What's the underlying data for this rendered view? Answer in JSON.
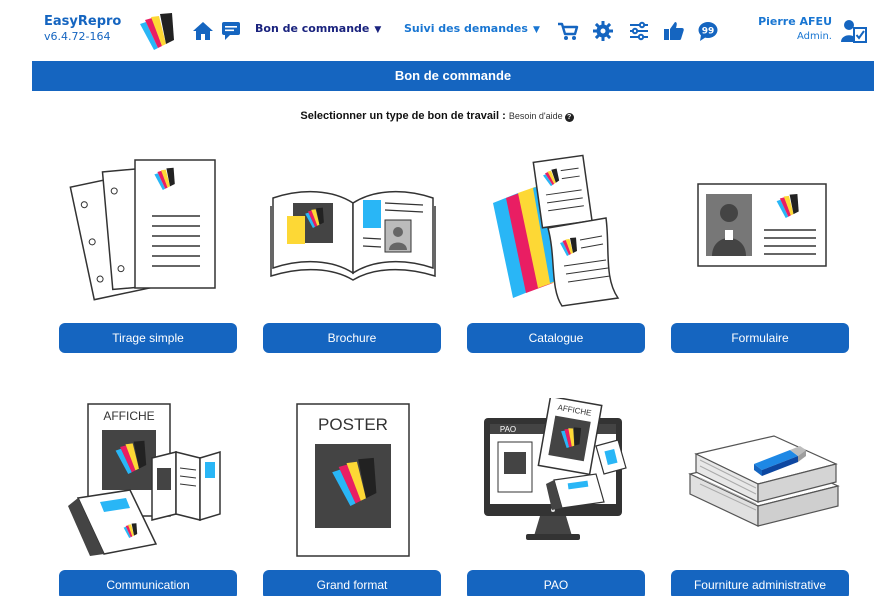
{
  "app": {
    "name": "EasyRepro",
    "version": "v6.4.72-164"
  },
  "nav": {
    "home_icon": "home-icon",
    "chat_icon": "chat-icon",
    "order_menu": "Bon de commande",
    "requests_menu": "Suivi des demandes",
    "cart_icon": "cart-icon",
    "settings_icon": "gear-icon",
    "filters_icon": "sliders-icon",
    "like_icon": "thumbs-up-icon",
    "feedback_icon": "speech-bubble-icon"
  },
  "user": {
    "name": "Pierre AFEU",
    "role": "Admin.",
    "icon": "user-settings-icon"
  },
  "page": {
    "title": "Bon de commande",
    "prompt": "Selectionner un type de bon de travail :",
    "help": "Besoin d'aide",
    "help_icon": "question-icon"
  },
  "cards": [
    {
      "label": "Tirage simple"
    },
    {
      "label": "Brochure"
    },
    {
      "label": "Catalogue"
    },
    {
      "label": "Formulaire"
    },
    {
      "label": "Communication",
      "illus_text": "AFFICHE"
    },
    {
      "label": "Grand format",
      "illus_text": "POSTER"
    },
    {
      "label": "PAO",
      "illus_text": "PAO",
      "illus_text2": "AFFICHE"
    },
    {
      "label": "Fourniture administrative"
    }
  ],
  "colors": {
    "primary": "#1565c0",
    "cyan": "#29b6f6",
    "magenta": "#e91e63",
    "yellow": "#fdd835",
    "dark": "#333333"
  }
}
